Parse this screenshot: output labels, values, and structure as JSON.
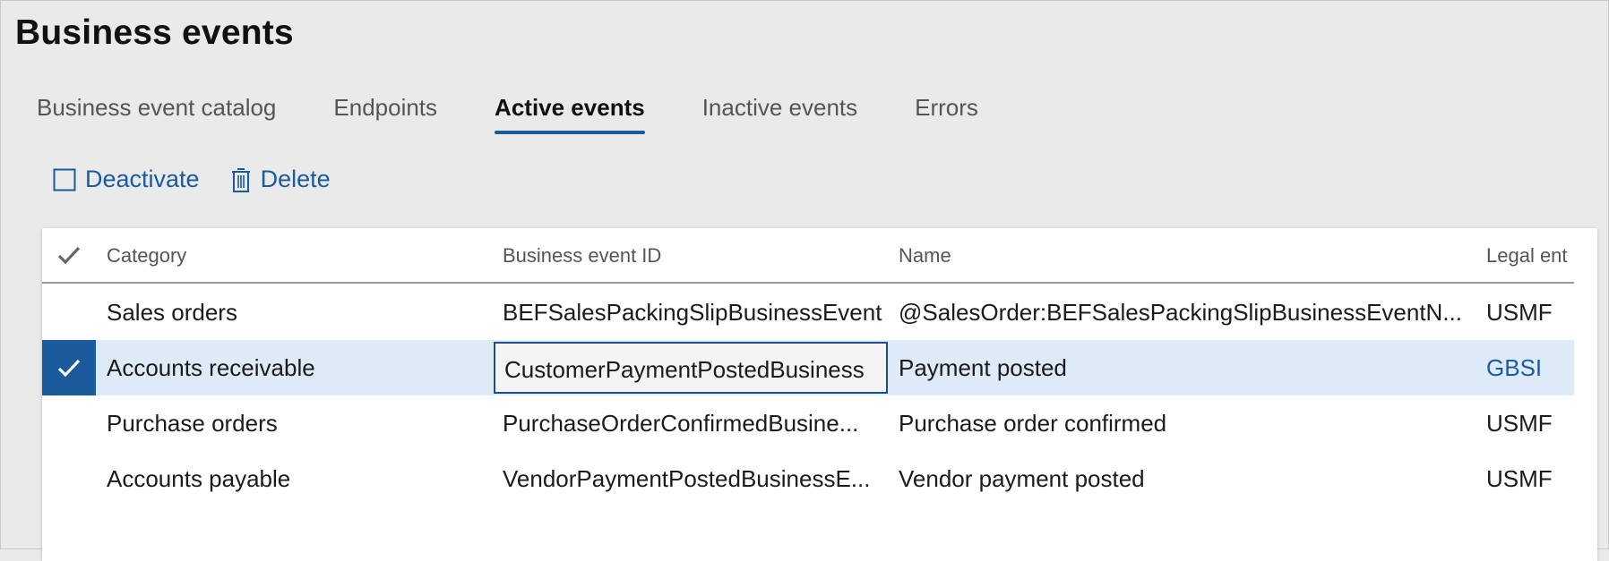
{
  "page": {
    "title": "Business events"
  },
  "tabs": [
    {
      "label": "Business event catalog",
      "active": false
    },
    {
      "label": "Endpoints",
      "active": false
    },
    {
      "label": "Active events",
      "active": true
    },
    {
      "label": "Inactive events",
      "active": false
    },
    {
      "label": "Errors",
      "active": false
    }
  ],
  "actions": {
    "deactivate": {
      "label": "Deactivate",
      "icon": "checkbox-outline-icon"
    },
    "delete": {
      "label": "Delete",
      "icon": "trash-icon"
    }
  },
  "grid": {
    "columns": {
      "category": "Category",
      "business_event_id": "Business event ID",
      "name": "Name",
      "legal_entity": "Legal ent"
    },
    "rows": [
      {
        "category": "Sales orders",
        "business_event_id": "BEFSalesPackingSlipBusinessEvent",
        "name": "@SalesOrder:BEFSalesPackingSlipBusinessEventN...",
        "legal_entity": "USMF",
        "selected": false
      },
      {
        "category": "Accounts receivable",
        "business_event_id": "CustomerPaymentPostedBusiness",
        "name": "Payment posted",
        "legal_entity": "GBSI",
        "selected": true
      },
      {
        "category": "Purchase orders",
        "business_event_id": "PurchaseOrderConfirmedBusine...",
        "name": "Purchase order confirmed",
        "legal_entity": "USMF",
        "selected": false
      },
      {
        "category": "Accounts payable",
        "business_event_id": "VendorPaymentPostedBusinessE...",
        "name": "Vendor payment posted",
        "legal_entity": "USMF",
        "selected": false
      }
    ]
  },
  "colors": {
    "accent": "#1a5a9e",
    "selected_row": "#deeaf7",
    "selected_marker": "#1b5b9c",
    "background": "#eaeaea"
  }
}
